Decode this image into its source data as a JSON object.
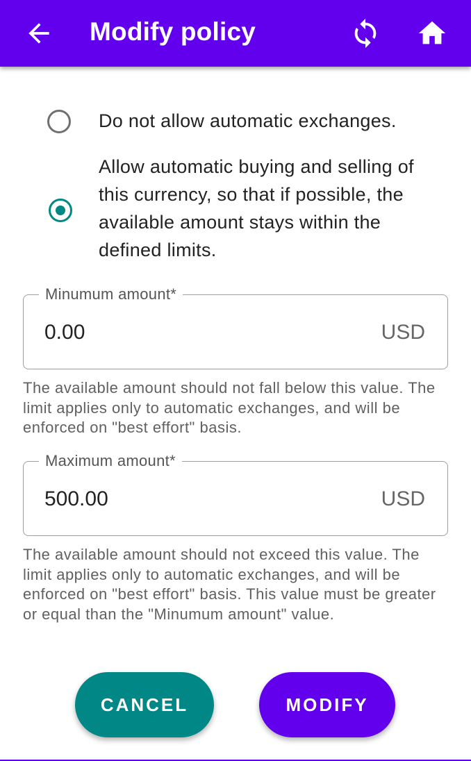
{
  "appbar": {
    "title": "Modify policy",
    "back_icon": "arrow-back-icon",
    "refresh_icon": "refresh-icon",
    "home_icon": "home-icon",
    "color": "#6200ee"
  },
  "policy": {
    "options": [
      {
        "label": "Do not allow automatic exchanges.",
        "selected": false
      },
      {
        "label": "Allow automatic buying and selling of this currency, so that if possible, the available amount stays within the defined limits.",
        "selected": true
      }
    ]
  },
  "min_field": {
    "label": "Minumum amount*",
    "value": "0.00",
    "suffix": "USD",
    "helper": "The available amount should not fall below this value. The limit applies only to automatic exchanges, and will be enforced on \"best effort\" basis."
  },
  "max_field": {
    "label": "Maximum amount*",
    "value": "500.00",
    "suffix": "USD",
    "helper": "The available amount should not exceed this value. The limit applies only to automatic exchanges, and will be enforced on \"best effort\" basis. This value must be greater or equal than the \"Minumum amount\" value."
  },
  "buttons": {
    "cancel": "CANCEL",
    "modify": "MODIFY"
  },
  "colors": {
    "primary": "#6200ee",
    "secondary": "#018786"
  }
}
